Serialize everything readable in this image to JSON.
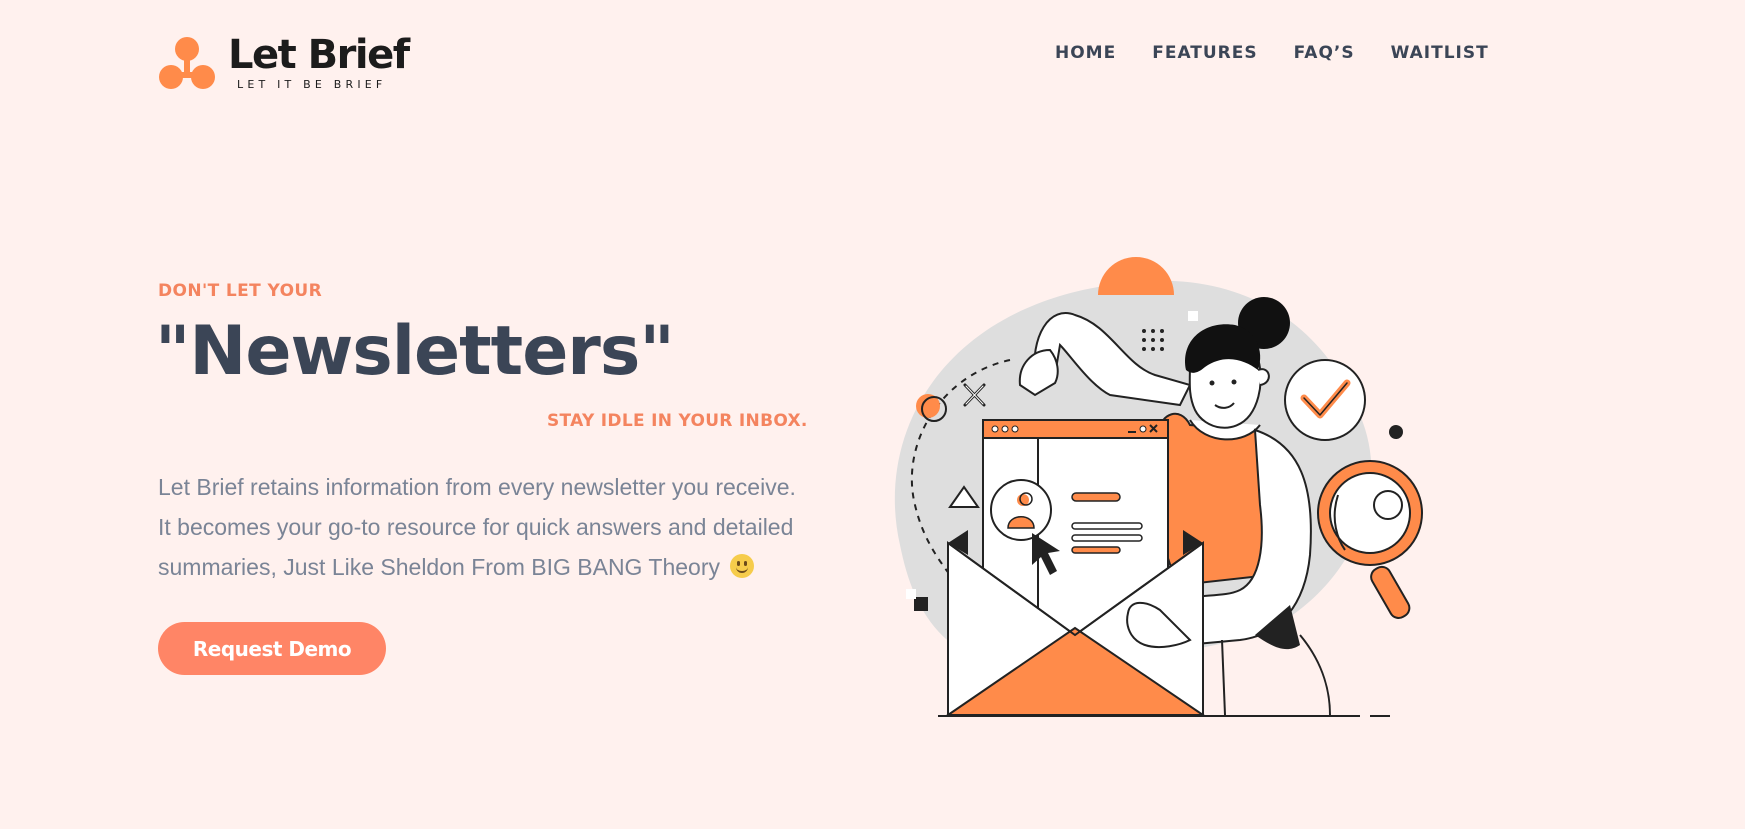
{
  "brand": {
    "name": "Let Brief",
    "tagline": "LET IT BE BRIEF",
    "accent": "#ff8b4a",
    "dark": "#3b4556"
  },
  "nav": {
    "items": [
      "HOME",
      "FEATURES",
      "FAQ’S",
      "WAITLIST"
    ]
  },
  "hero": {
    "eyebrow": "DON'T LET YOUR",
    "headline": "\"Newsletters\"",
    "subline": "STAY IDLE IN YOUR INBOX.",
    "description": [
      "Let Brief retains information from every newsletter you receive.",
      "It becomes your go-to resource for quick answers and detailed",
      "summaries, Just Like Sheldon From BIG BANG Theory"
    ],
    "emoji": "slightly-smiling-face-icon",
    "cta_label": "Request Demo",
    "cta_color": "#ff8566",
    "text_accent": "#f4845f"
  }
}
